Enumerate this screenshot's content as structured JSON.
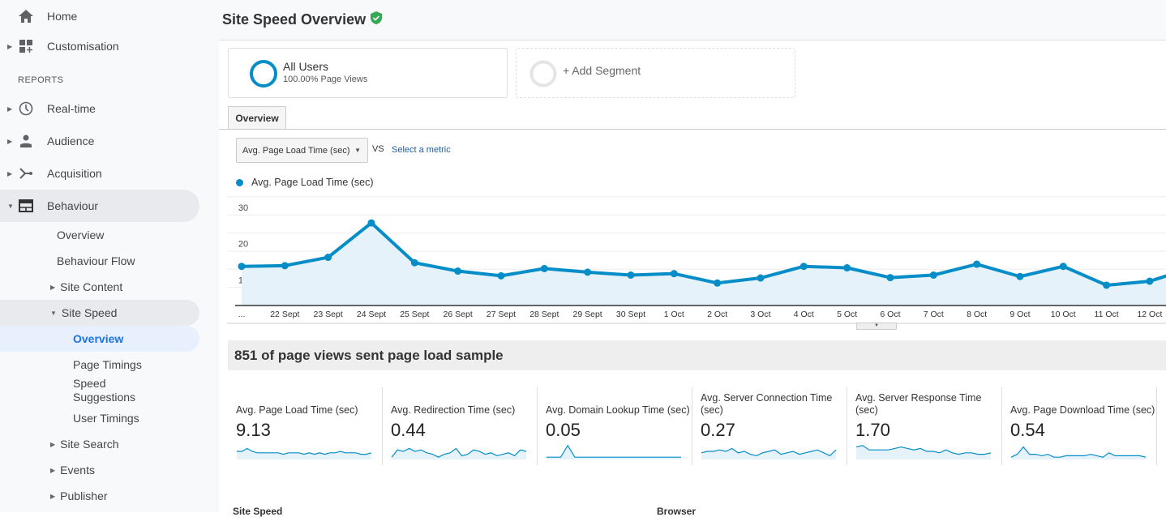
{
  "sidebar": {
    "top": [
      {
        "label": "Home",
        "icon": "home-icon"
      },
      {
        "label": "Customisation",
        "icon": "dashboard-icon"
      }
    ],
    "section": "REPORTS",
    "reports": [
      {
        "label": "Real-time",
        "icon": "clock-icon"
      },
      {
        "label": "Audience",
        "icon": "person-icon"
      },
      {
        "label": "Acquisition",
        "icon": "acquisition-icon"
      },
      {
        "label": "Behaviour",
        "icon": "behaviour-icon"
      }
    ],
    "behaviour_items": [
      "Overview",
      "Behaviour Flow",
      "Site Content",
      "Site Speed"
    ],
    "site_speed_items": [
      "Overview",
      "Page Timings",
      "Speed Suggestions",
      "User Timings"
    ],
    "more_items": [
      "Site Search",
      "Events",
      "Publisher"
    ]
  },
  "header": {
    "title": "Site Speed Overview",
    "verified_color": "#34a853"
  },
  "segments": {
    "all_users": "All Users",
    "all_users_sub": "100.00% Page Views",
    "add": "+ Add Segment"
  },
  "tab": "Overview",
  "metric_select": {
    "selected": "Avg. Page Load Time (sec)",
    "vs": "VS",
    "other": "Select a metric"
  },
  "accent": "#058dc7",
  "chart_data": {
    "type": "area",
    "legend": "Avg. Page Load Time (sec)",
    "yticks": [
      "30",
      "20",
      "10"
    ],
    "ylim": [
      0,
      30
    ],
    "grid": true,
    "categories": [
      "...",
      "22 Sept",
      "23 Sept",
      "24 Sept",
      "25 Sept",
      "26 Sept",
      "27 Sept",
      "28 Sept",
      "29 Sept",
      "30 Sept",
      "1 Oct",
      "2 Oct",
      "3 Oct",
      "4 Oct",
      "5 Oct",
      "6 Oct",
      "7 Oct",
      "8 Oct",
      "9 Oct",
      "10 Oct",
      "11 Oct",
      "12 Oct"
    ],
    "values": [
      10.8,
      11.0,
      13.3,
      22.8,
      11.8,
      9.5,
      8.2,
      10.2,
      9.2,
      8.4,
      8.8,
      6.2,
      7.6,
      10.8,
      10.4,
      7.7,
      8.4,
      11.4,
      8.0,
      10.8,
      5.6,
      6.7
    ]
  },
  "sample_title": "851 of page views sent page load sample",
  "metrics": [
    {
      "title": "Avg. Page Load Time (sec)",
      "value": "9.13",
      "spark": [
        5,
        5,
        7,
        5,
        4,
        4,
        4,
        4,
        4,
        3,
        4,
        4,
        4,
        3,
        4,
        3,
        4,
        3,
        4,
        4,
        5,
        4,
        4,
        4,
        3,
        3,
        4
      ]
    },
    {
      "title": "Avg. Redirection Time (sec)",
      "value": "0.44",
      "spark": [
        1,
        6,
        5,
        7,
        5,
        6,
        4,
        3,
        1,
        3,
        4,
        7,
        2,
        3,
        6,
        5,
        3,
        4,
        2,
        3,
        4,
        2,
        6,
        5
      ]
    },
    {
      "title": "Avg. Domain Lookup Time (sec)",
      "value": "0.05",
      "spark": [
        1,
        1,
        1,
        9,
        1,
        1,
        1,
        1,
        1,
        1,
        1,
        1,
        1,
        1,
        1,
        1,
        1,
        1,
        1,
        1
      ]
    },
    {
      "title": "Avg. Server Connection Time (sec)",
      "value": "0.27",
      "spark": [
        4,
        5,
        5,
        6,
        5,
        7,
        4,
        5,
        3,
        2,
        4,
        5,
        6,
        3,
        4,
        5,
        3,
        4,
        5,
        6,
        4,
        2,
        6
      ]
    },
    {
      "title": "Avg. Server Response Time (sec)",
      "value": "1.70",
      "spark": [
        8,
        9,
        6,
        6,
        6,
        6,
        7,
        8,
        7,
        6,
        7,
        5,
        5,
        4,
        6,
        4,
        3,
        4,
        4,
        3,
        3,
        4
      ]
    },
    {
      "title": "Avg. Page Download Time (sec)",
      "value": "0.54",
      "spark": [
        1,
        3,
        8,
        3,
        3,
        2,
        3,
        1,
        1,
        2,
        2,
        2,
        2,
        3,
        2,
        1,
        4,
        2,
        2,
        2,
        2,
        2,
        1
      ]
    }
  ],
  "bottom": {
    "left": "Site Speed",
    "right": "Browser"
  }
}
